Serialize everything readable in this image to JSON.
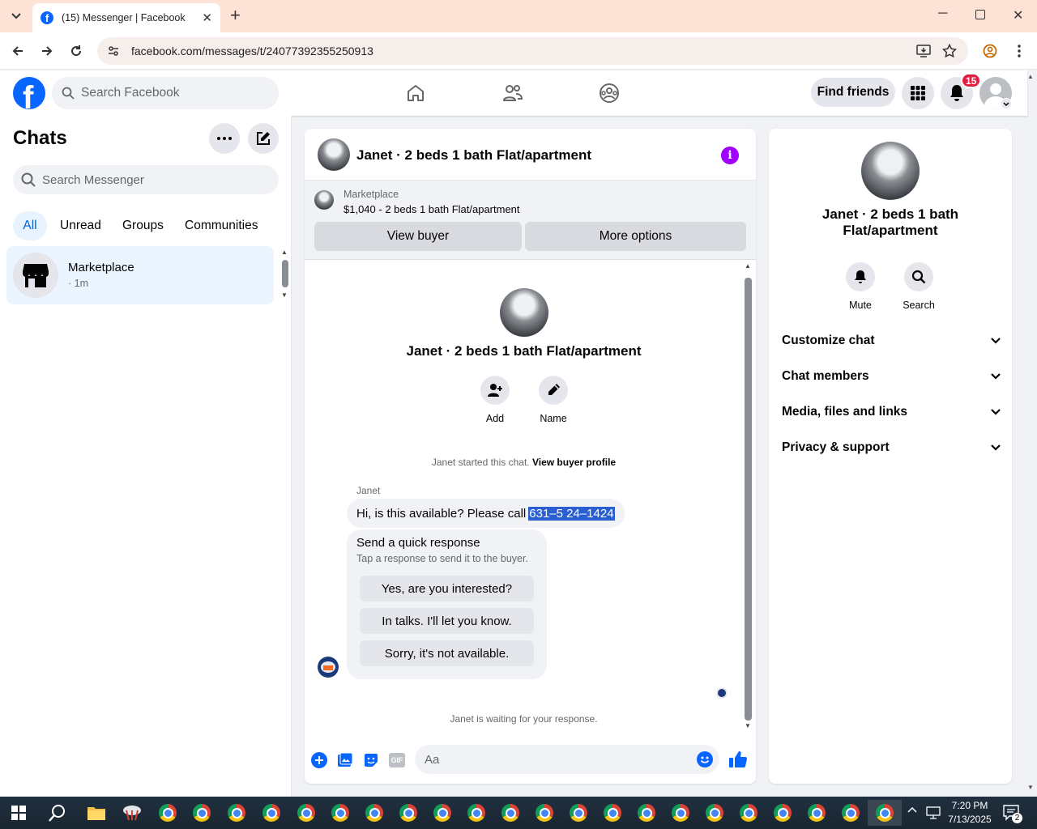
{
  "browser": {
    "tab_title": "(15) Messenger | Facebook",
    "url": "facebook.com/messages/t/24077392355250913"
  },
  "header": {
    "search_placeholder": "Search Facebook",
    "find_friends": "Find friends",
    "notification_count": "15",
    "brand_color": "#0866ff"
  },
  "sidebar": {
    "title": "Chats",
    "search_placeholder": "Search Messenger",
    "filters": [
      "All",
      "Unread",
      "Groups",
      "Communities"
    ],
    "conversation": {
      "name": "Marketplace",
      "time": "· 1m"
    }
  },
  "conversation": {
    "title": "Janet · 2 beds 1 bath Flat/apartment",
    "marketplace_label": "Marketplace",
    "listing": "$1,040 - 2 beds 1 bath Flat/apartment",
    "view_buyer": "View buyer",
    "more_options": "More options",
    "profile_name": "Janet · 2 beds 1 bath Flat/apartment",
    "add_label": "Add",
    "name_label": "Name",
    "started_text": "Janet started this chat.",
    "view_profile_link": "View buyer profile",
    "sender": "Janet",
    "message_prefix": "Hi, is this available? Please call",
    "message_phone": "631–5 24–1424",
    "quick_title": "Send a quick response",
    "quick_subtitle": "Tap a response to send it to the buyer.",
    "quick_responses": [
      "Yes, are you interested?",
      "In talks. I'll let you know.",
      "Sorry, it's not available."
    ],
    "waiting_text": "Janet is waiting for your response.",
    "composer_placeholder": "Aa"
  },
  "details": {
    "name": "Janet · 2 beds 1 bath Flat/apartment",
    "mute": "Mute",
    "search": "Search",
    "sections": [
      "Customize chat",
      "Chat members",
      "Media, files and links",
      "Privacy & support"
    ]
  },
  "taskbar": {
    "time": "7:20 PM",
    "date": "7/13/2025",
    "notification_count": "2"
  }
}
